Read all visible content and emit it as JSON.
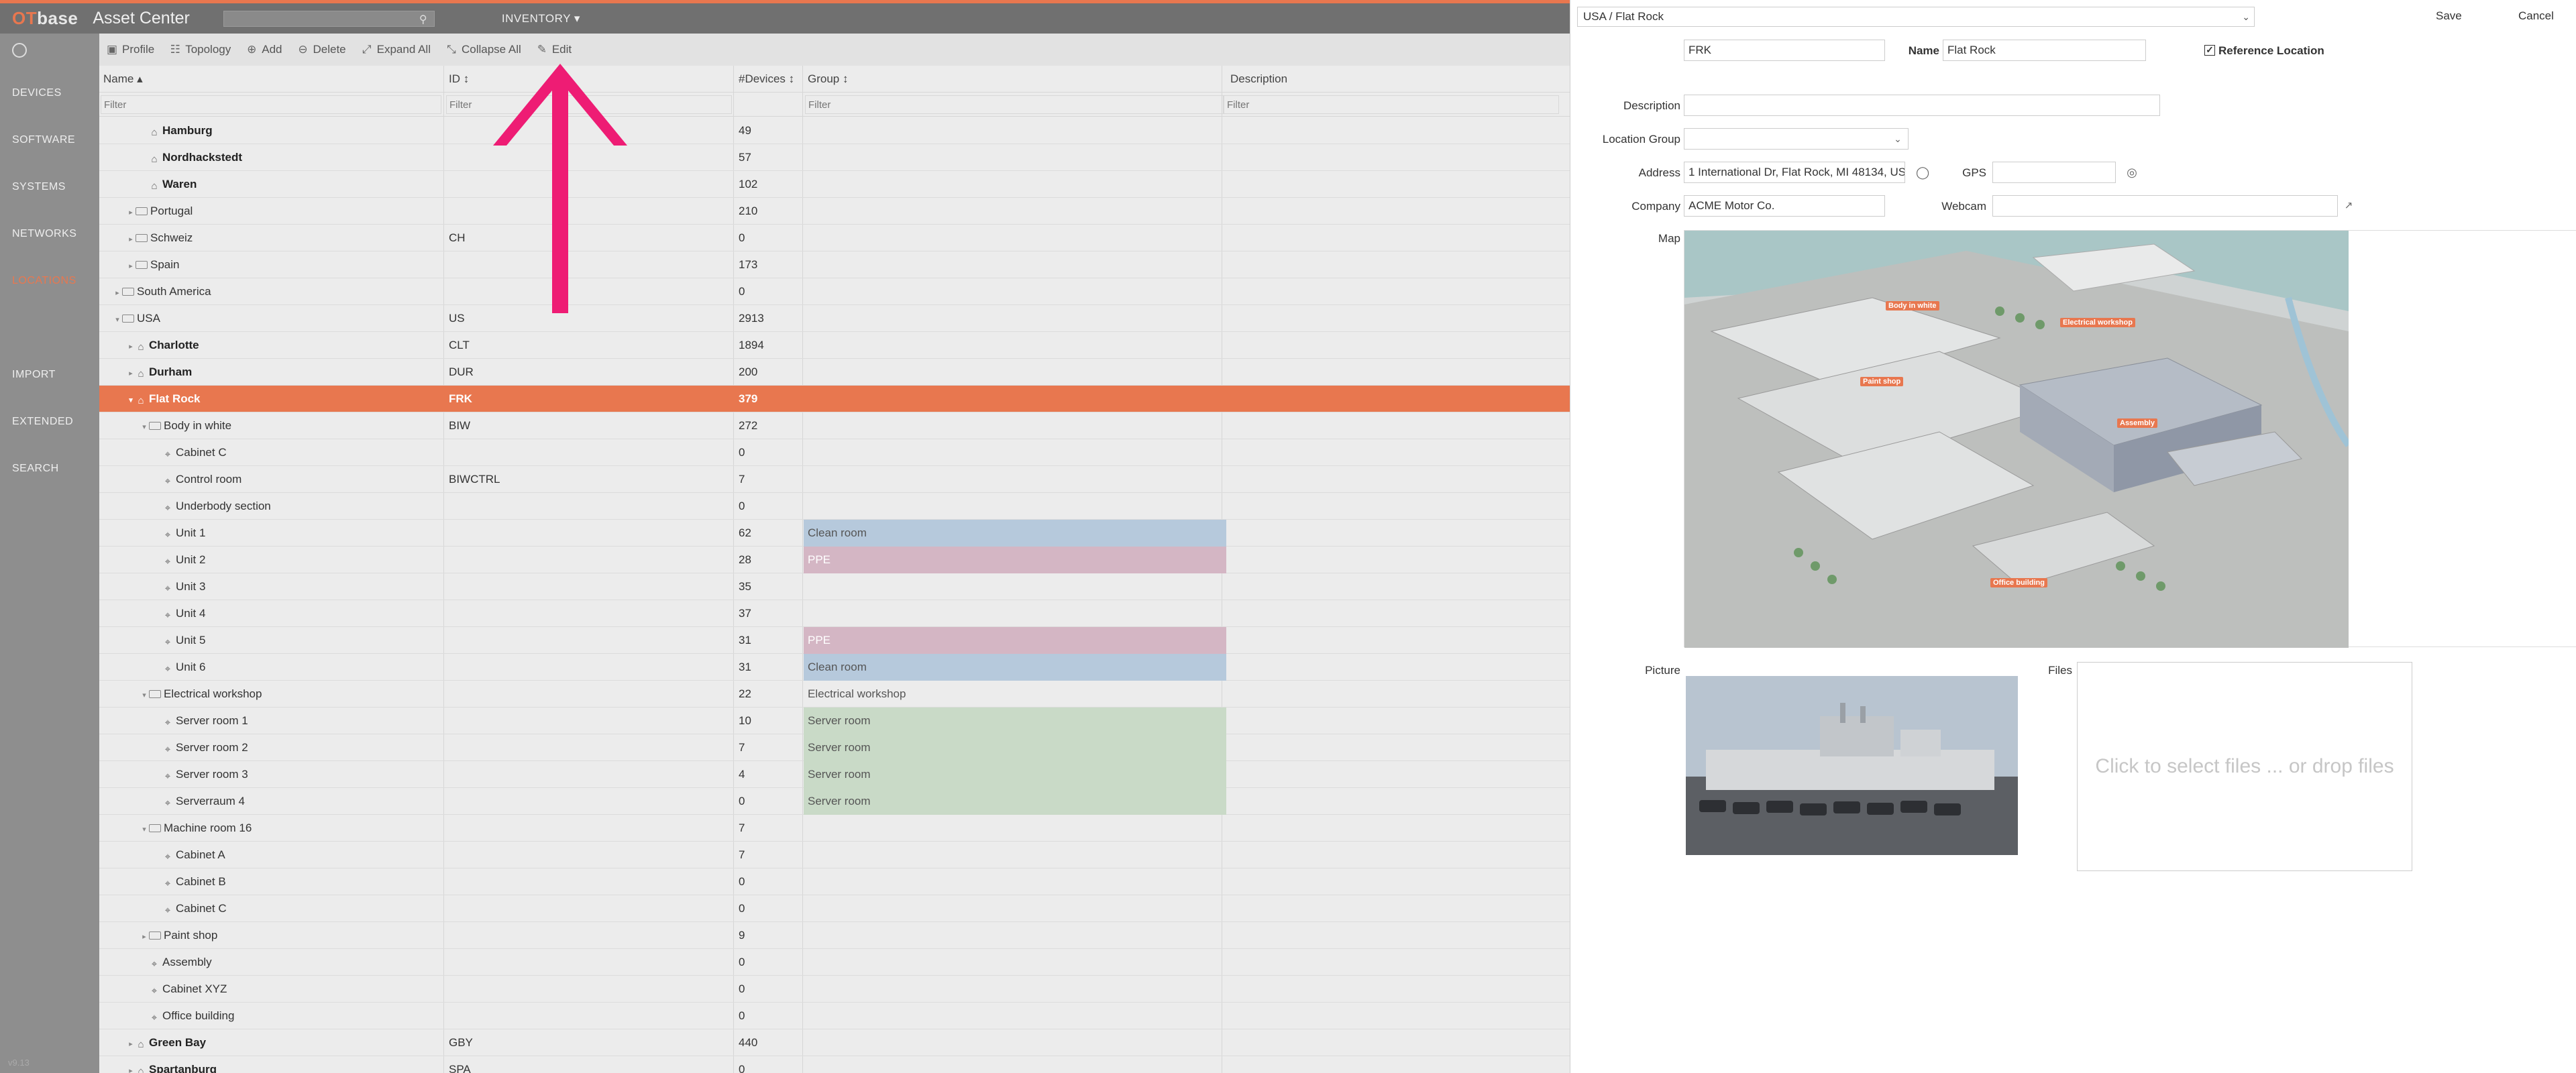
{
  "app": {
    "logo_ot": "OT",
    "logo_rest": "base",
    "title": "Asset Center",
    "search_value": "",
    "inventory_menu": "INVENTORY ▾"
  },
  "sidebar": {
    "items": [
      {
        "label": "DEVICES"
      },
      {
        "label": "SOFTWARE"
      },
      {
        "label": "SYSTEMS"
      },
      {
        "label": "NETWORKS"
      },
      {
        "label": "LOCATIONS"
      },
      {
        "label": "IMPORT"
      },
      {
        "label": "EXTENDED"
      },
      {
        "label": "SEARCH"
      }
    ],
    "version": "v9.13"
  },
  "toolbar": {
    "profile": "Profile",
    "topology": "Topology",
    "add": "Add",
    "delete": "Delete",
    "expand_all": "Expand All",
    "collapse_all": "Collapse All",
    "edit": "Edit"
  },
  "grid": {
    "headers": {
      "name": "Name ▴",
      "id": "ID ↕",
      "devices": "#Devices ↕",
      "group": "Group ↕",
      "description": "Description"
    },
    "filter_placeholder": "Filter",
    "rows": [
      {
        "name": "Hamburg",
        "id": "",
        "dev": "49",
        "grp": "",
        "indent": 2,
        "icon": "site",
        "bold": true,
        "tog": ""
      },
      {
        "name": "Nordhackstedt",
        "id": "",
        "dev": "57",
        "grp": "",
        "indent": 2,
        "icon": "site",
        "bold": true,
        "tog": ""
      },
      {
        "name": "Waren",
        "id": "",
        "dev": "102",
        "grp": "",
        "indent": 2,
        "icon": "site",
        "bold": true,
        "tog": ""
      },
      {
        "name": "Portugal",
        "id": "",
        "dev": "210",
        "grp": "",
        "indent": 1,
        "icon": "folder",
        "bold": false,
        "tog": "▸"
      },
      {
        "name": "Schweiz",
        "id": "CH",
        "dev": "0",
        "grp": "",
        "indent": 1,
        "icon": "folder",
        "bold": false,
        "tog": "▸"
      },
      {
        "name": "Spain",
        "id": "",
        "dev": "173",
        "grp": "",
        "indent": 1,
        "icon": "folder",
        "bold": false,
        "tog": "▸"
      },
      {
        "name": "South America",
        "id": "",
        "dev": "0",
        "grp": "",
        "indent": 0,
        "icon": "folder",
        "bold": false,
        "tog": "▸"
      },
      {
        "name": "USA",
        "id": "US",
        "dev": "2913",
        "grp": "",
        "indent": 0,
        "icon": "folder",
        "bold": false,
        "tog": "▾"
      },
      {
        "name": "Charlotte",
        "id": "CLT",
        "dev": "1894",
        "grp": "",
        "indent": 1,
        "icon": "site",
        "bold": true,
        "tog": "▸"
      },
      {
        "name": "Durham",
        "id": "DUR",
        "dev": "200",
        "grp": "",
        "indent": 1,
        "icon": "site",
        "bold": true,
        "tog": "▸"
      },
      {
        "name": "Flat Rock",
        "id": "FRK",
        "dev": "379",
        "grp": "",
        "indent": 1,
        "icon": "site",
        "bold": true,
        "tog": "▾",
        "selected": true
      },
      {
        "name": "Body in white",
        "id": "BIW",
        "dev": "272",
        "grp": "",
        "indent": 2,
        "icon": "folder",
        "bold": false,
        "tog": "▾"
      },
      {
        "name": "Cabinet C",
        "id": "",
        "dev": "0",
        "grp": "",
        "indent": 3,
        "icon": "pin",
        "bold": false,
        "tog": ""
      },
      {
        "name": "Control room",
        "id": "BIWCTRL",
        "dev": "7",
        "grp": "",
        "indent": 3,
        "icon": "pin",
        "bold": false,
        "tog": ""
      },
      {
        "name": "Underbody section",
        "id": "",
        "dev": "0",
        "grp": "",
        "indent": 3,
        "icon": "pin",
        "bold": false,
        "tog": ""
      },
      {
        "name": "Unit 1",
        "id": "",
        "dev": "62",
        "grp": "Clean room",
        "grpc": "clean",
        "indent": 3,
        "icon": "pin",
        "bold": false,
        "tog": ""
      },
      {
        "name": "Unit 2",
        "id": "",
        "dev": "28",
        "grp": "PPE",
        "grpc": "ppe",
        "indent": 3,
        "icon": "pin",
        "bold": false,
        "tog": ""
      },
      {
        "name": "Unit 3",
        "id": "",
        "dev": "35",
        "grp": "",
        "indent": 3,
        "icon": "pin",
        "bold": false,
        "tog": ""
      },
      {
        "name": "Unit 4",
        "id": "",
        "dev": "37",
        "grp": "",
        "indent": 3,
        "icon": "pin",
        "bold": false,
        "tog": ""
      },
      {
        "name": "Unit 5",
        "id": "",
        "dev": "31",
        "grp": "PPE",
        "grpc": "ppe",
        "indent": 3,
        "icon": "pin",
        "bold": false,
        "tog": ""
      },
      {
        "name": "Unit 6",
        "id": "",
        "dev": "31",
        "grp": "Clean room",
        "grpc": "clean",
        "indent": 3,
        "icon": "pin",
        "bold": false,
        "tog": ""
      },
      {
        "name": "Electrical workshop",
        "id": "",
        "dev": "22",
        "grp": "Electrical workshop",
        "grpc": "elec",
        "indent": 2,
        "icon": "folder",
        "bold": false,
        "tog": "▾"
      },
      {
        "name": "Server room 1",
        "id": "",
        "dev": "10",
        "grp": "Server room",
        "grpc": "server",
        "indent": 3,
        "icon": "pin",
        "bold": false,
        "tog": ""
      },
      {
        "name": "Server room 2",
        "id": "",
        "dev": "7",
        "grp": "Server room",
        "grpc": "server",
        "indent": 3,
        "icon": "pin",
        "bold": false,
        "tog": ""
      },
      {
        "name": "Server room 3",
        "id": "",
        "dev": "4",
        "grp": "Server room",
        "grpc": "server",
        "indent": 3,
        "icon": "pin",
        "bold": false,
        "tog": ""
      },
      {
        "name": "Serverraum 4",
        "id": "",
        "dev": "0",
        "grp": "Server room",
        "grpc": "server",
        "indent": 3,
        "icon": "pin",
        "bold": false,
        "tog": ""
      },
      {
        "name": "Machine room 16",
        "id": "",
        "dev": "7",
        "grp": "",
        "indent": 2,
        "icon": "folder",
        "bold": false,
        "tog": "▾"
      },
      {
        "name": "Cabinet A",
        "id": "",
        "dev": "7",
        "grp": "",
        "indent": 3,
        "icon": "pin",
        "bold": false,
        "tog": ""
      },
      {
        "name": "Cabinet B",
        "id": "",
        "dev": "0",
        "grp": "",
        "indent": 3,
        "icon": "pin",
        "bold": false,
        "tog": ""
      },
      {
        "name": "Cabinet C",
        "id": "",
        "dev": "0",
        "grp": "",
        "indent": 3,
        "icon": "pin",
        "bold": false,
        "tog": ""
      },
      {
        "name": "Paint shop",
        "id": "",
        "dev": "9",
        "grp": "",
        "indent": 2,
        "icon": "folder",
        "bold": false,
        "tog": "▸"
      },
      {
        "name": "Assembly",
        "id": "",
        "dev": "0",
        "grp": "",
        "indent": 2,
        "icon": "pin",
        "bold": false,
        "tog": ""
      },
      {
        "name": "Cabinet XYZ",
        "id": "",
        "dev": "0",
        "grp": "",
        "indent": 2,
        "icon": "pin",
        "bold": false,
        "tog": ""
      },
      {
        "name": "Office building",
        "id": "",
        "dev": "0",
        "grp": "",
        "indent": 2,
        "icon": "pin",
        "bold": false,
        "tog": ""
      },
      {
        "name": "Green Bay",
        "id": "GBY",
        "dev": "440",
        "grp": "",
        "indent": 1,
        "icon": "site",
        "bold": true,
        "tog": "▸"
      },
      {
        "name": "Spartanburg",
        "id": "SPA",
        "dev": "0",
        "grp": "",
        "indent": 1,
        "icon": "site",
        "bold": true,
        "tog": "▸"
      }
    ]
  },
  "panel": {
    "breadcrumb": "USA / Flat Rock",
    "save": "Save",
    "cancel": "Cancel",
    "labels": {
      "id": "ID",
      "name": "Name",
      "reference": "Reference Location",
      "description": "Description",
      "location_group": "Location Group",
      "address": "Address",
      "gps": "GPS",
      "company": "Company",
      "webcam": "Webcam",
      "map": "Map",
      "picture": "Picture",
      "files": "Files"
    },
    "values": {
      "id": "FRK",
      "name": "Flat Rock",
      "reference_checked": "✓",
      "description": "",
      "location_group": "",
      "address": "1 International Dr, Flat Rock, MI 48134, US",
      "gps": "",
      "company": "ACME Motor Co.",
      "webcam": ""
    },
    "files_hint": "Click to select files ... or drop files",
    "map_labels": [
      "Body in white",
      "Electrical workshop",
      "Paint shop",
      "Assembly",
      "Office building"
    ]
  },
  "colors": {
    "accent": "#e8774f",
    "topbar": "#707070",
    "sidebar": "#8e8e8e",
    "clean_room": "#b6c9dc",
    "ppe": "#d4b6c4",
    "server_room": "#c9dac7",
    "arrow": "#ee1c74"
  }
}
